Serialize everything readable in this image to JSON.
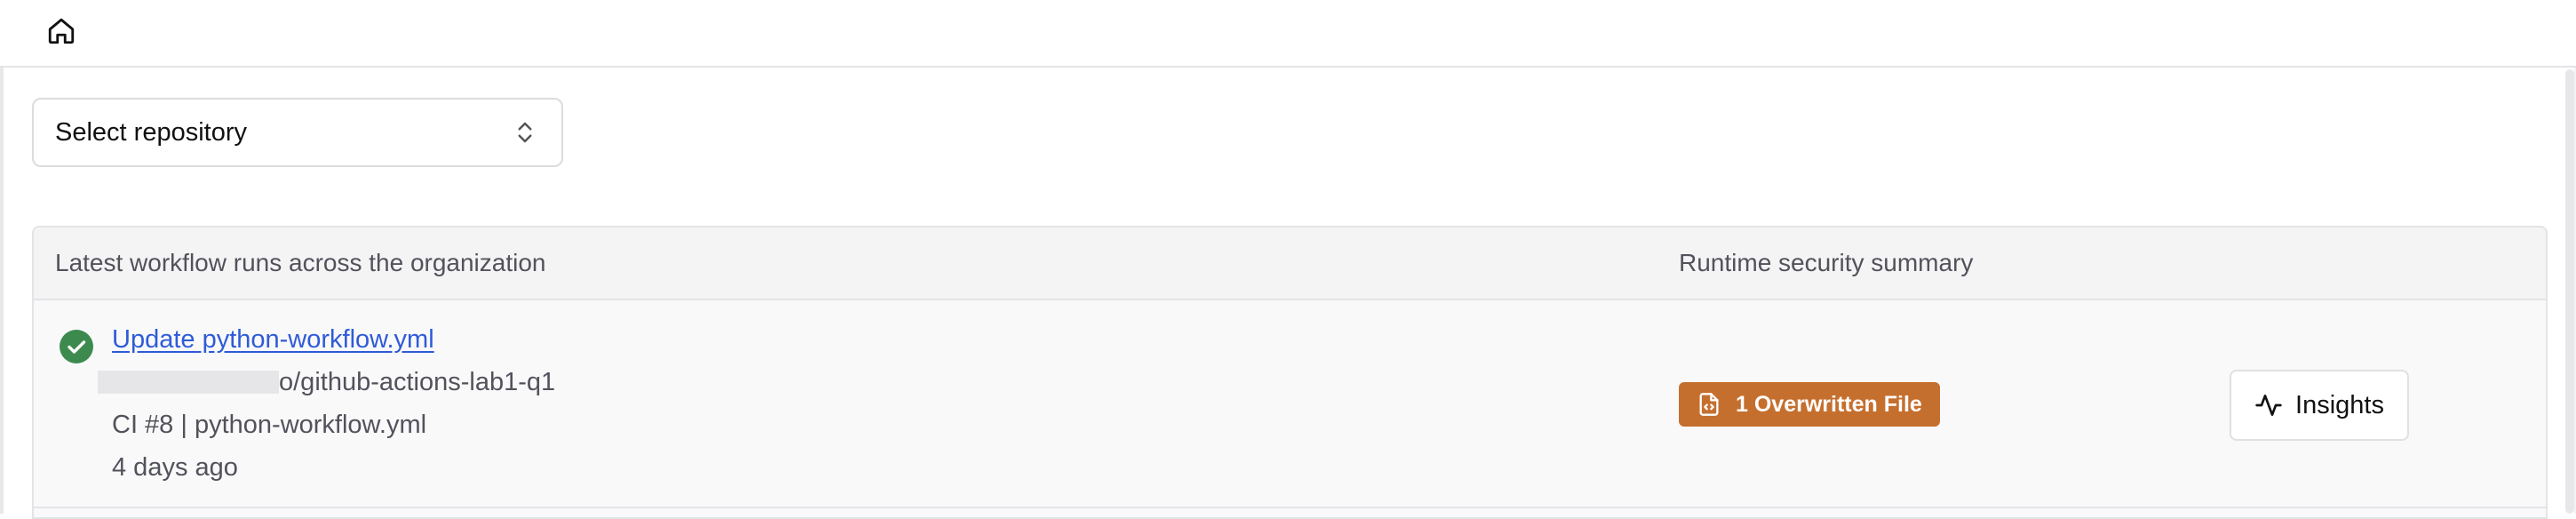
{
  "nav": {
    "home_icon": "home-icon"
  },
  "repo_select": {
    "label": "Select repository",
    "icon": "chevron-up-down-icon"
  },
  "table": {
    "headers": {
      "runs": "Latest workflow runs across the organization",
      "summary": "Runtime security summary"
    },
    "rows": [
      {
        "status": "success",
        "status_color": "#3d8a4e",
        "title": "Update python-workflow.yml",
        "repo_suffix": "o/github-actions-lab1-q1",
        "meta": "CI #8 | python-workflow.yml",
        "time": "4 days ago",
        "badge": {
          "label": "1 Overwritten File",
          "color": "#c56f2e",
          "icon": "file-code-icon"
        },
        "action": {
          "label": "Insights",
          "icon": "activity-icon"
        }
      }
    ]
  }
}
